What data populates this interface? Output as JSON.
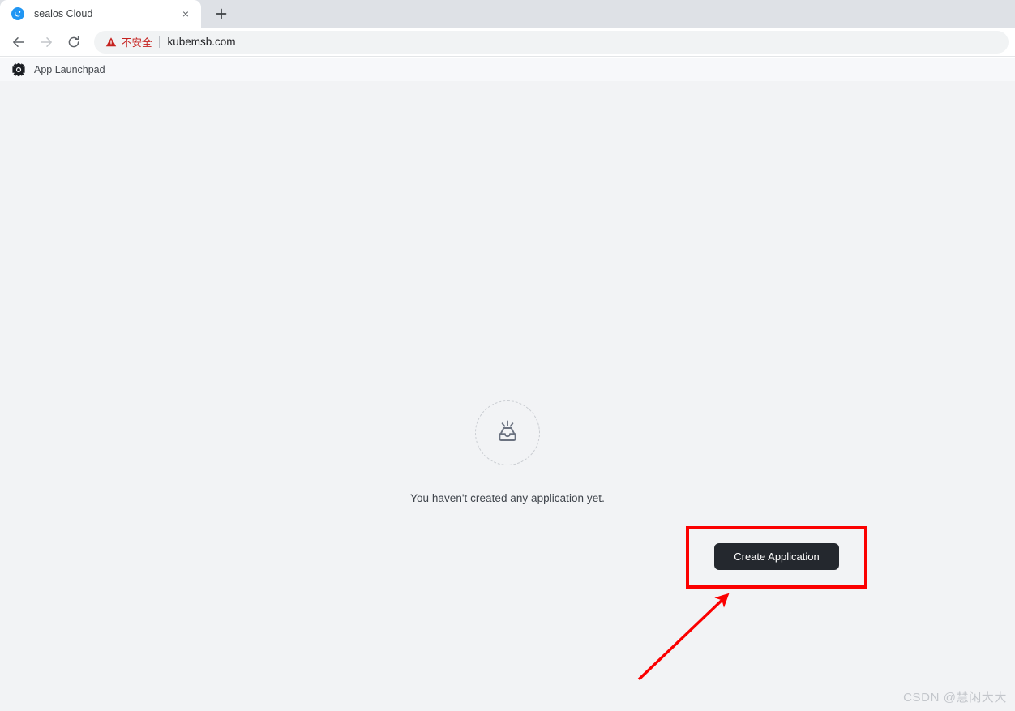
{
  "browser": {
    "tab": {
      "title": "sealos Cloud",
      "favicon": "sealos-favicon",
      "close_label": "×"
    },
    "new_tab_label": "+",
    "nav": {
      "back": "back-arrow",
      "forward": "forward-arrow",
      "reload": "reload-icon"
    },
    "omnibox": {
      "security_icon": "warning-triangle-icon",
      "security_label": "不安全",
      "url": "kubemsb.com"
    }
  },
  "app": {
    "header": {
      "logo": "sealos-gem-icon",
      "title": "App Launchpad"
    },
    "empty_state": {
      "icon": "inbox-empty-icon",
      "message": "You haven't created any application yet.",
      "button_label": "Create Application"
    }
  },
  "annotations": {
    "highlight_box": "red-rectangle",
    "pointer": "red-arrow"
  },
  "watermark": "CSDN @慧闲大大",
  "colors": {
    "tabstrip_bg": "#dee1e6",
    "page_bg": "#f2f3f5",
    "app_header_bg": "#f7f8fa",
    "button_bg": "#24282e",
    "annotation_red": "#fb0000",
    "not_secure_red": "#c5221f",
    "favicon_blue": "#2196f3",
    "empty_icon_gray": "#6b7280"
  }
}
